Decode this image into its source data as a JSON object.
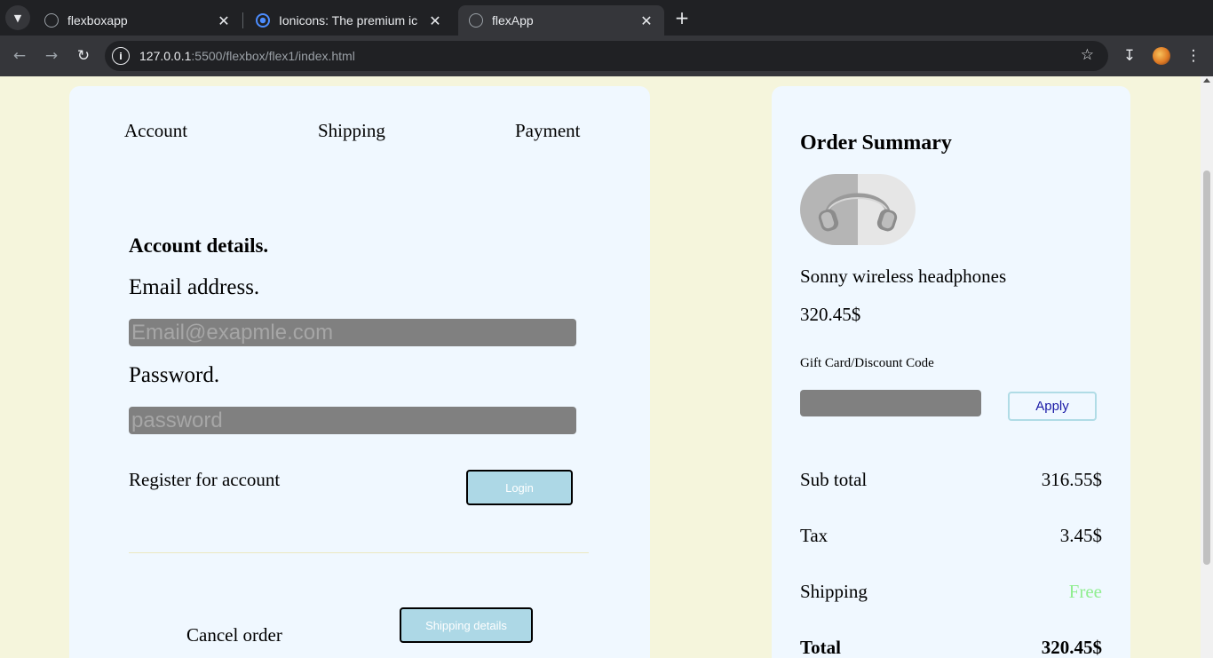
{
  "browser": {
    "tabs": [
      {
        "title": "flexboxapp",
        "favicon": "globe-icon",
        "active": false
      },
      {
        "title": "Ionicons: The premium ic",
        "favicon": "ionicons-icon",
        "active": false
      },
      {
        "title": "flexApp",
        "favicon": "globe-icon",
        "active": true
      }
    ],
    "url_host": "127.0.0.1",
    "url_rest": ":5500/flexbox/flex1/index.html"
  },
  "steps": [
    "Account",
    "Shipping",
    "Payment"
  ],
  "account": {
    "heading": "Account details.",
    "email_label": "Email address.",
    "email_placeholder": "Email@exapmle.com",
    "password_label": "Password.",
    "password_placeholder": "password",
    "register_text": "Register for account",
    "login_label": "Login",
    "cancel_label": "Cancel order",
    "shipping_details_label": "Shipping details"
  },
  "summary": {
    "title": "Order Summary",
    "product_name": "Sonny wireless headphones",
    "product_price": "320.45$",
    "gift_label": "Gift Card/Discount Code",
    "apply_label": "Apply",
    "rows": [
      {
        "label": "Sub total",
        "value": "316.55$"
      },
      {
        "label": "Tax",
        "value": "3.45$"
      },
      {
        "label": "Shipping",
        "value": "Free"
      },
      {
        "label": "Total",
        "value": "320.45$"
      }
    ]
  },
  "colors": {
    "page_bg": "#f5f5dc",
    "card_bg": "#f0f8ff",
    "input_bg": "#808080",
    "button_bg": "#add8e6",
    "free_text": "#90ee90"
  }
}
